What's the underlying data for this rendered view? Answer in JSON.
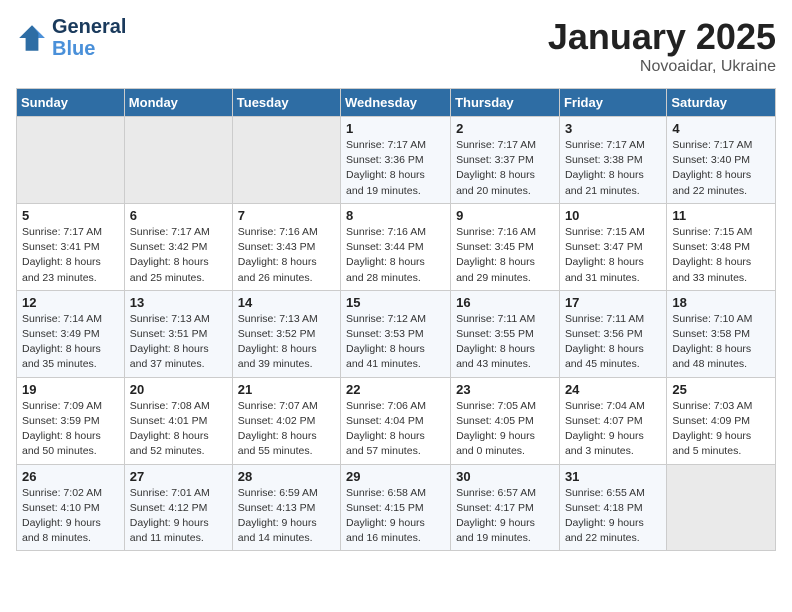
{
  "header": {
    "logo_line1": "General",
    "logo_line2": "Blue",
    "month": "January 2025",
    "location": "Novoaidar, Ukraine"
  },
  "days_of_week": [
    "Sunday",
    "Monday",
    "Tuesday",
    "Wednesday",
    "Thursday",
    "Friday",
    "Saturday"
  ],
  "weeks": [
    [
      {
        "day": "",
        "info": ""
      },
      {
        "day": "",
        "info": ""
      },
      {
        "day": "",
        "info": ""
      },
      {
        "day": "1",
        "info": "Sunrise: 7:17 AM\nSunset: 3:36 PM\nDaylight: 8 hours\nand 19 minutes."
      },
      {
        "day": "2",
        "info": "Sunrise: 7:17 AM\nSunset: 3:37 PM\nDaylight: 8 hours\nand 20 minutes."
      },
      {
        "day": "3",
        "info": "Sunrise: 7:17 AM\nSunset: 3:38 PM\nDaylight: 8 hours\nand 21 minutes."
      },
      {
        "day": "4",
        "info": "Sunrise: 7:17 AM\nSunset: 3:40 PM\nDaylight: 8 hours\nand 22 minutes."
      }
    ],
    [
      {
        "day": "5",
        "info": "Sunrise: 7:17 AM\nSunset: 3:41 PM\nDaylight: 8 hours\nand 23 minutes."
      },
      {
        "day": "6",
        "info": "Sunrise: 7:17 AM\nSunset: 3:42 PM\nDaylight: 8 hours\nand 25 minutes."
      },
      {
        "day": "7",
        "info": "Sunrise: 7:16 AM\nSunset: 3:43 PM\nDaylight: 8 hours\nand 26 minutes."
      },
      {
        "day": "8",
        "info": "Sunrise: 7:16 AM\nSunset: 3:44 PM\nDaylight: 8 hours\nand 28 minutes."
      },
      {
        "day": "9",
        "info": "Sunrise: 7:16 AM\nSunset: 3:45 PM\nDaylight: 8 hours\nand 29 minutes."
      },
      {
        "day": "10",
        "info": "Sunrise: 7:15 AM\nSunset: 3:47 PM\nDaylight: 8 hours\nand 31 minutes."
      },
      {
        "day": "11",
        "info": "Sunrise: 7:15 AM\nSunset: 3:48 PM\nDaylight: 8 hours\nand 33 minutes."
      }
    ],
    [
      {
        "day": "12",
        "info": "Sunrise: 7:14 AM\nSunset: 3:49 PM\nDaylight: 8 hours\nand 35 minutes."
      },
      {
        "day": "13",
        "info": "Sunrise: 7:13 AM\nSunset: 3:51 PM\nDaylight: 8 hours\nand 37 minutes."
      },
      {
        "day": "14",
        "info": "Sunrise: 7:13 AM\nSunset: 3:52 PM\nDaylight: 8 hours\nand 39 minutes."
      },
      {
        "day": "15",
        "info": "Sunrise: 7:12 AM\nSunset: 3:53 PM\nDaylight: 8 hours\nand 41 minutes."
      },
      {
        "day": "16",
        "info": "Sunrise: 7:11 AM\nSunset: 3:55 PM\nDaylight: 8 hours\nand 43 minutes."
      },
      {
        "day": "17",
        "info": "Sunrise: 7:11 AM\nSunset: 3:56 PM\nDaylight: 8 hours\nand 45 minutes."
      },
      {
        "day": "18",
        "info": "Sunrise: 7:10 AM\nSunset: 3:58 PM\nDaylight: 8 hours\nand 48 minutes."
      }
    ],
    [
      {
        "day": "19",
        "info": "Sunrise: 7:09 AM\nSunset: 3:59 PM\nDaylight: 8 hours\nand 50 minutes."
      },
      {
        "day": "20",
        "info": "Sunrise: 7:08 AM\nSunset: 4:01 PM\nDaylight: 8 hours\nand 52 minutes."
      },
      {
        "day": "21",
        "info": "Sunrise: 7:07 AM\nSunset: 4:02 PM\nDaylight: 8 hours\nand 55 minutes."
      },
      {
        "day": "22",
        "info": "Sunrise: 7:06 AM\nSunset: 4:04 PM\nDaylight: 8 hours\nand 57 minutes."
      },
      {
        "day": "23",
        "info": "Sunrise: 7:05 AM\nSunset: 4:05 PM\nDaylight: 9 hours\nand 0 minutes."
      },
      {
        "day": "24",
        "info": "Sunrise: 7:04 AM\nSunset: 4:07 PM\nDaylight: 9 hours\nand 3 minutes."
      },
      {
        "day": "25",
        "info": "Sunrise: 7:03 AM\nSunset: 4:09 PM\nDaylight: 9 hours\nand 5 minutes."
      }
    ],
    [
      {
        "day": "26",
        "info": "Sunrise: 7:02 AM\nSunset: 4:10 PM\nDaylight: 9 hours\nand 8 minutes."
      },
      {
        "day": "27",
        "info": "Sunrise: 7:01 AM\nSunset: 4:12 PM\nDaylight: 9 hours\nand 11 minutes."
      },
      {
        "day": "28",
        "info": "Sunrise: 6:59 AM\nSunset: 4:13 PM\nDaylight: 9 hours\nand 14 minutes."
      },
      {
        "day": "29",
        "info": "Sunrise: 6:58 AM\nSunset: 4:15 PM\nDaylight: 9 hours\nand 16 minutes."
      },
      {
        "day": "30",
        "info": "Sunrise: 6:57 AM\nSunset: 4:17 PM\nDaylight: 9 hours\nand 19 minutes."
      },
      {
        "day": "31",
        "info": "Sunrise: 6:55 AM\nSunset: 4:18 PM\nDaylight: 9 hours\nand 22 minutes."
      },
      {
        "day": "",
        "info": ""
      }
    ]
  ]
}
